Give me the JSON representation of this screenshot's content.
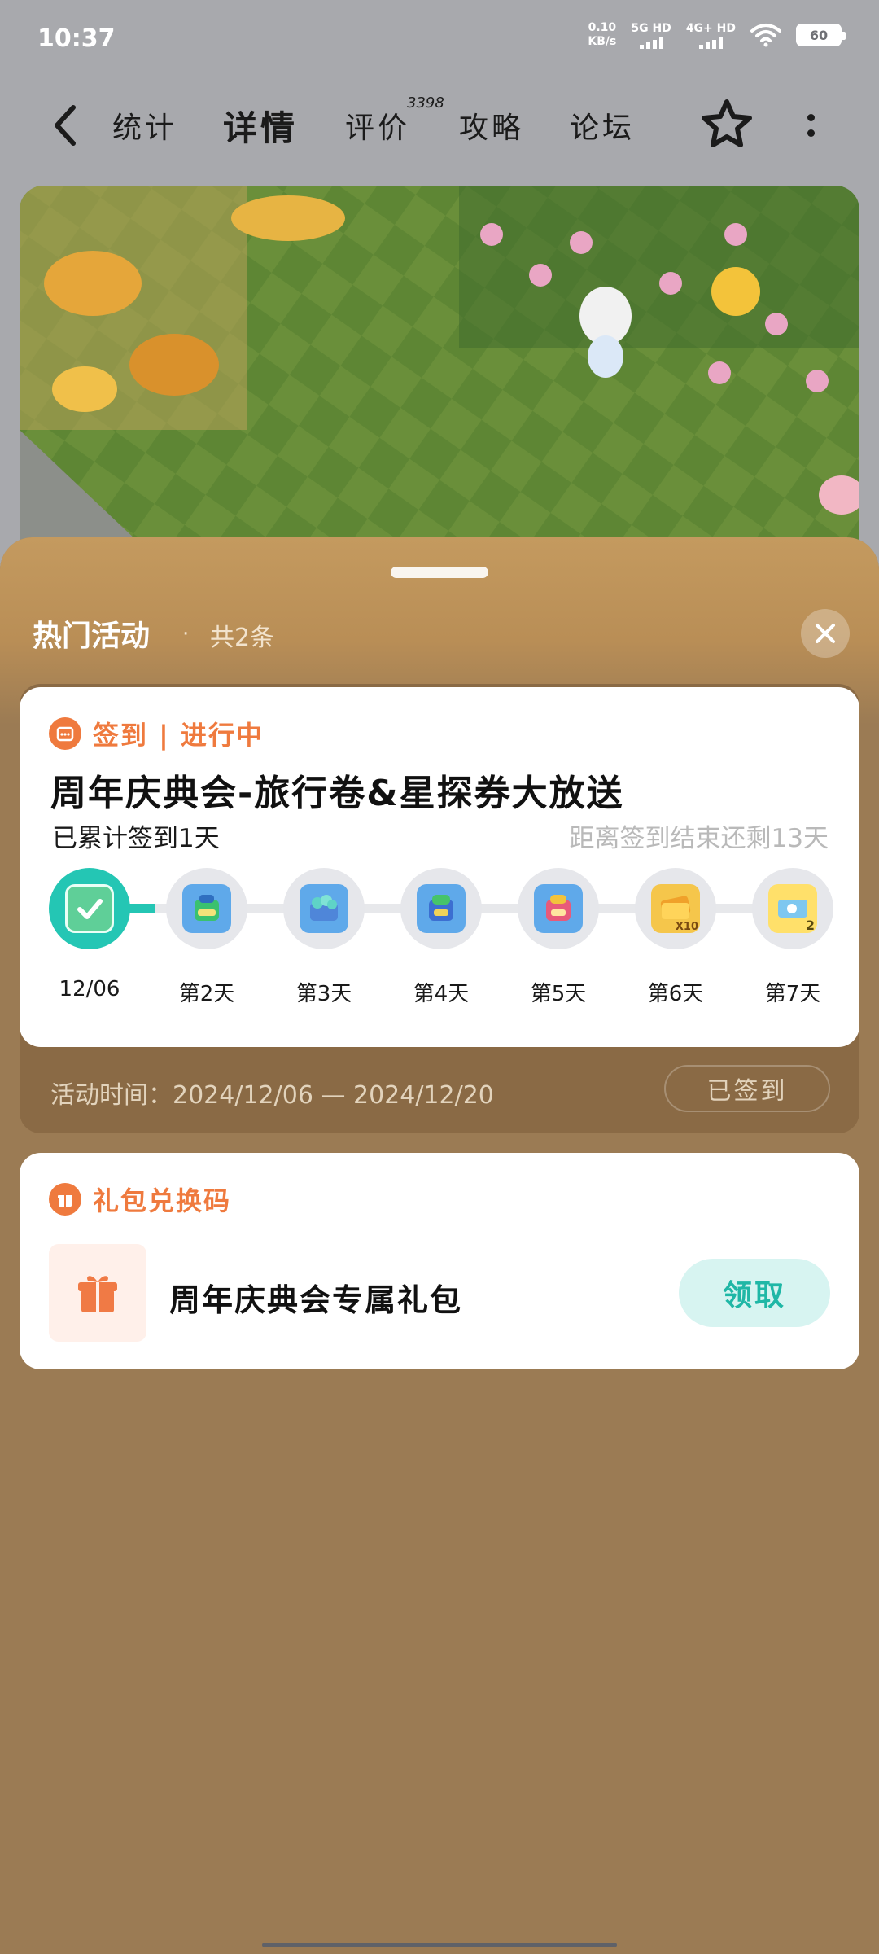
{
  "status_bar": {
    "time": "10:37",
    "net_speed_value": "0.10",
    "net_speed_unit": "KB/s",
    "network_1": "5G HD",
    "network_2": "4G+ HD",
    "battery": "60"
  },
  "nav": {
    "tabs": [
      {
        "label": "统计"
      },
      {
        "label": "详情"
      },
      {
        "label": "评价"
      },
      {
        "label": "攻略"
      },
      {
        "label": "论坛"
      }
    ],
    "active_tab": "详情",
    "review_count": "3398"
  },
  "sheet": {
    "title": "热门活动",
    "separator": "·",
    "count": "共2条"
  },
  "checkin": {
    "category": "签到 | 进行中",
    "title": "周年庆典会-旅行卷&星探券大放送",
    "progress": "已累计签到1天",
    "remaining": "距离签到结束还剩13天",
    "days": [
      {
        "label": "12/06",
        "done": true,
        "icon": "check-icon"
      },
      {
        "label": "第2天",
        "done": false,
        "icon": "backpack-reward-icon"
      },
      {
        "label": "第3天",
        "done": false,
        "icon": "gem-reward-icon"
      },
      {
        "label": "第4天",
        "done": false,
        "icon": "backpack-reward-icon"
      },
      {
        "label": "第5天",
        "done": false,
        "icon": "backpack-reward-icon"
      },
      {
        "label": "第6天",
        "done": false,
        "icon": "ticket-reward-icon",
        "badge": "X10"
      },
      {
        "label": "第7天",
        "done": false,
        "icon": "ticket-reward-icon",
        "badge": "2"
      }
    ],
    "time_range": "活动时间：2024/12/06 — 2024/12/20",
    "signed_label": "已签到"
  },
  "gift": {
    "category": "礼包兑换码",
    "name": "周年庆典会专属礼包",
    "claim_label": "领取"
  },
  "colors": {
    "accent": "#24c6b4",
    "orange": "#ef7a3e",
    "sheet_bg": "#9b7b54"
  }
}
